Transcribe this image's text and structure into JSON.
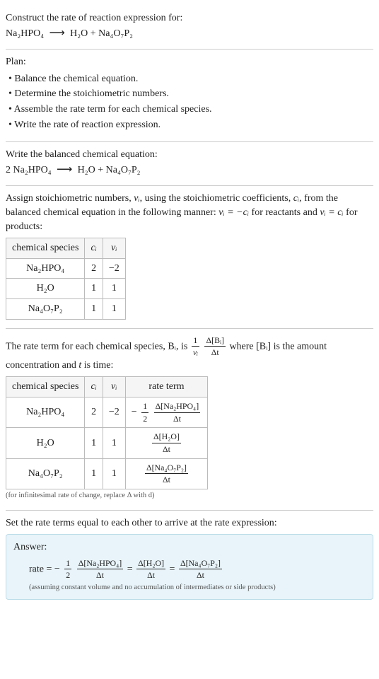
{
  "header": {
    "title": "Construct the rate of reaction expression for:",
    "reaction": {
      "lhs": "Na₂HPO₄",
      "arrow": "⟶",
      "rhs": "H₂O + Na₄O₇P₂"
    }
  },
  "plan": {
    "title": "Plan:",
    "items": [
      "Balance the chemical equation.",
      "Determine the stoichiometric numbers.",
      "Assemble the rate term for each chemical species.",
      "Write the rate of reaction expression."
    ]
  },
  "balanced": {
    "title": "Write the balanced chemical equation:",
    "lhs": "2 Na₂HPO₄",
    "arrow": "⟶",
    "rhs": "H₂O + Na₄O₇P₂"
  },
  "assign": {
    "text_a": "Assign stoichiometric numbers, ",
    "vi": "νᵢ",
    "text_b": ", using the stoichiometric coefficients, ",
    "ci": "cᵢ",
    "text_c": ", from the balanced chemical equation in the following manner: ",
    "eq1": "νᵢ = −cᵢ",
    "text_d": " for reactants and ",
    "eq2": "νᵢ = cᵢ",
    "text_e": " for products:",
    "table": {
      "head": [
        "chemical species",
        "cᵢ",
        "νᵢ"
      ],
      "rows": [
        {
          "sp": "Na₂HPO₄",
          "c": "2",
          "v": "−2"
        },
        {
          "sp": "H₂O",
          "c": "1",
          "v": "1"
        },
        {
          "sp": "Na₄O₇P₂",
          "c": "1",
          "v": "1"
        }
      ]
    }
  },
  "rateterm": {
    "text_a": "The rate term for each chemical species, ",
    "bi": "Bᵢ",
    "text_b": ", is ",
    "frac1_top": "1",
    "frac1_bot": "νᵢ",
    "frac2_top": "Δ[Bᵢ]",
    "frac2_bot": "Δt",
    "text_c": " where [Bᵢ] is the amount concentration and ",
    "t": "t",
    "text_d": " is time:",
    "table": {
      "head": [
        "chemical species",
        "cᵢ",
        "νᵢ",
        "rate term"
      ],
      "rows": [
        {
          "sp": "Na₂HPO₄",
          "c": "2",
          "v": "−2",
          "neg": "−",
          "ft": "1",
          "fb": "2",
          "dt": "Δ[Na₂HPO₄]",
          "db": "Δt"
        },
        {
          "sp": "H₂O",
          "c": "1",
          "v": "1",
          "neg": "",
          "ft": "",
          "fb": "",
          "dt": "Δ[H₂O]",
          "db": "Δt"
        },
        {
          "sp": "Na₄O₇P₂",
          "c": "1",
          "v": "1",
          "neg": "",
          "ft": "",
          "fb": "",
          "dt": "Δ[Na₄O₇P₂]",
          "db": "Δt"
        }
      ]
    },
    "note": "(for infinitesimal rate of change, replace Δ with d)"
  },
  "setequal": "Set the rate terms equal to each other to arrive at the rate expression:",
  "answer": {
    "label": "Answer:",
    "rateword": "rate = ",
    "neg": "−",
    "half_top": "1",
    "half_bot": "2",
    "t1_top": "Δ[Na₂HPO₄]",
    "t1_bot": "Δt",
    "eq": " = ",
    "t2_top": "Δ[H₂O]",
    "t2_bot": "Δt",
    "t3_top": "Δ[Na₄O₇P₂]",
    "t3_bot": "Δt",
    "assump": "(assuming constant volume and no accumulation of intermediates or side products)"
  }
}
